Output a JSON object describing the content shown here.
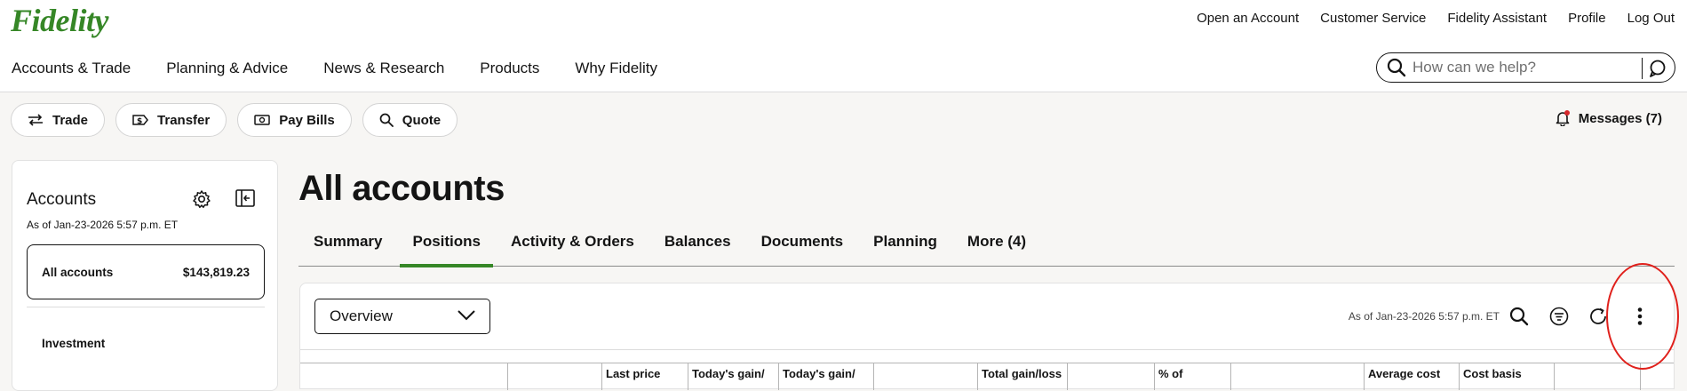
{
  "brand": {
    "logo_text": "Fidelity",
    "accent_color": "#368727"
  },
  "utility_nav": [
    "Open an Account",
    "Customer Service",
    "Fidelity Assistant",
    "Profile",
    "Log Out"
  ],
  "main_nav": [
    "Accounts & Trade",
    "Planning & Advice",
    "News & Research",
    "Products",
    "Why Fidelity"
  ],
  "search": {
    "placeholder": "How can we help?",
    "icon": "search-icon",
    "chat_icon": "chat-icon"
  },
  "quick_actions": [
    {
      "label": "Trade",
      "icon": "swap-arrows-icon"
    },
    {
      "label": "Transfer",
      "icon": "dollar-transfer-icon"
    },
    {
      "label": "Pay Bills",
      "icon": "cash-icon"
    },
    {
      "label": "Quote",
      "icon": "search-icon"
    }
  ],
  "messages": {
    "label": "Messages (7)",
    "icon": "bell-icon",
    "alert_color": "#d6272b"
  },
  "sidebar": {
    "title": "Accounts",
    "as_of": "As of Jan-23-2026 5:57 p.m. ET",
    "all_accounts_label": "All accounts",
    "all_accounts_value": "$143,819.23",
    "group_label": "Investment"
  },
  "page": {
    "title": "All accounts",
    "tabs": [
      "Summary",
      "Positions",
      "Activity & Orders",
      "Balances",
      "Documents",
      "Planning",
      "More (4)"
    ],
    "active_tab": "Positions"
  },
  "positions_panel": {
    "view_select": "Overview",
    "as_of": "As of Jan-23-2026 5:57 p.m. ET",
    "tools": [
      "search-icon",
      "filter-icon",
      "refresh-icon",
      "more-vertical-icon"
    ],
    "columns": [
      "",
      "",
      "Last price",
      "Today's gain/",
      "Today's gain/",
      "",
      "Total gain/loss",
      "",
      "% of",
      "",
      "Average cost",
      "Cost basis",
      "",
      ""
    ]
  },
  "annotation": {
    "ring_color": "#e0201b"
  }
}
